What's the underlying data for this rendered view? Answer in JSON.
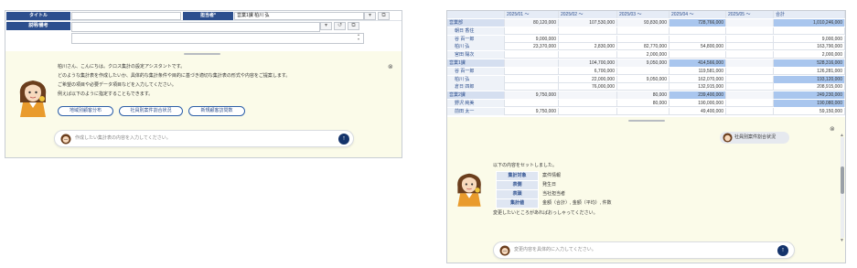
{
  "left": {
    "form": {
      "title_label": "タイトル",
      "owner_label": "担当者*",
      "owner_value": "営業1課 柏川 弘",
      "desc_label": "説明/備考"
    },
    "chat": {
      "message_lines": [
        "柏川さん、こんにちは。クロス集計の設定アシスタントです。",
        "どのような集計表を作成したいか、具体的な集計条件や目的に基づき適切な集計表の形式や内容をご提案します。",
        "ご希望の項目や必要データ項目などを入力してください。",
        "例えば以下のように指定することもできます。"
      ],
      "suggestions": [
        "地域別顧客分布",
        "社員別案件割合状況",
        "新規顧客訪問数"
      ],
      "input_placeholder": "作成したい集計表の内容を入力してください。"
    }
  },
  "right": {
    "table": {
      "headers": [
        "",
        "2025/01 ～",
        "2025/02 ～",
        "2025/03 ～",
        "2025/04 ～",
        "2025/05 ～",
        "合計"
      ],
      "rows": [
        {
          "label": "営業部",
          "vals": [
            "80,120,000",
            "107,530,000",
            "93,830,000",
            "728,766,000",
            "",
            "1,010,246,000"
          ],
          "hl": [
            3,
            5
          ]
        },
        {
          "label": "朝日 香住",
          "vals": [
            "",
            "",
            "",
            "",
            "",
            ""
          ],
          "hl": []
        },
        {
          "label": "谷 百一郎",
          "vals": [
            "9,000,000",
            "",
            "",
            "",
            "",
            "9,000,000"
          ],
          "hl": []
        },
        {
          "label": "柏川 弘",
          "vals": [
            "23,370,000",
            "2,830,000",
            "82,770,000",
            "54,800,000",
            "",
            "163,790,000"
          ],
          "hl": []
        },
        {
          "label": "宮田 陽次",
          "vals": [
            "",
            "",
            "2,000,000",
            "",
            "",
            "2,000,000"
          ],
          "hl": []
        },
        {
          "label": "営業1課",
          "vals": [
            "",
            "104,700,000",
            "9,050,000",
            "414,566,000",
            "",
            "528,316,000"
          ],
          "hl": [
            3,
            5
          ]
        },
        {
          "label": "谷 百一郎",
          "vals": [
            "",
            "6,700,000",
            "",
            "119,581,000",
            "",
            "126,281,000"
          ],
          "hl": []
        },
        {
          "label": "柏川 弘",
          "vals": [
            "",
            "22,000,000",
            "9,050,000",
            "162,070,000",
            "",
            "193,120,000"
          ],
          "hl": [
            5
          ]
        },
        {
          "label": "倉日 四郎",
          "vals": [
            "",
            "76,000,000",
            "",
            "132,915,000",
            "",
            "208,915,000"
          ],
          "hl": []
        },
        {
          "label": "営業2課",
          "vals": [
            "9,750,000",
            "",
            "80,000",
            "239,400,000",
            "",
            "249,230,000"
          ],
          "hl": [
            3,
            5
          ]
        },
        {
          "label": "野沢 純美",
          "vals": [
            "",
            "",
            "80,000",
            "190,000,000",
            "",
            "190,080,000"
          ],
          "hl": [
            5
          ]
        },
        {
          "label": "前田 太一",
          "vals": [
            "9,750,000",
            "",
            "",
            "49,400,000",
            "",
            "59,150,000"
          ],
          "hl": []
        }
      ]
    },
    "chat": {
      "user_chip": "社員別案件割合状況",
      "intro": "以下の内容をセットしました。",
      "config": [
        {
          "key": "集計対象",
          "value": "案件情報"
        },
        {
          "key": "表側",
          "value": "発生日"
        },
        {
          "key": "表頭",
          "value": "当社担当者"
        },
        {
          "key": "集計値",
          "value": "金額（合計）, 金額（平均）, 件数"
        }
      ],
      "outro": "変更したいところがあればおっしゃってください。",
      "input_placeholder": "変更内容を具体的に入力してください。"
    }
  }
}
